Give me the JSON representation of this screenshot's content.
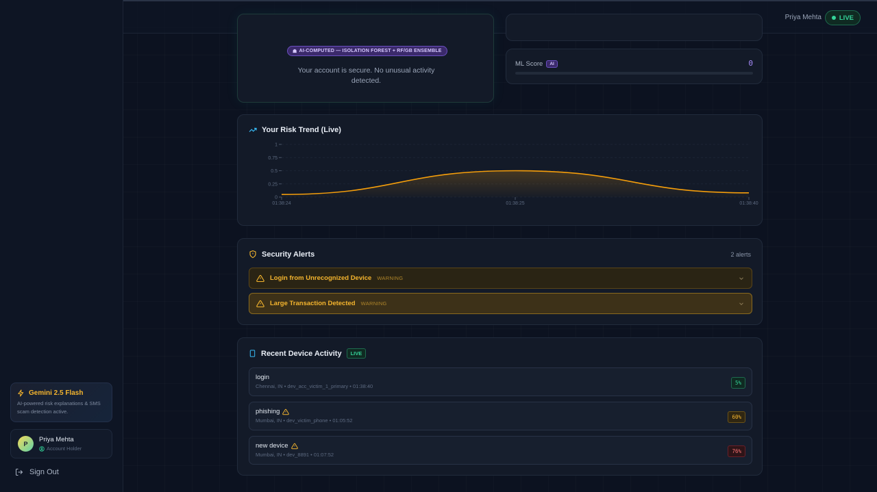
{
  "sidebar": {
    "gemini": {
      "title": "Gemini 2.5 Flash",
      "description": "AI-powered risk explanations & SMS scam detection active."
    },
    "user": {
      "initial": "P",
      "name": "Priya Mehta",
      "role": "Account Holder"
    },
    "signout_label": "Sign Out"
  },
  "topbar": {
    "user_name": "Priya Mehta",
    "live_label": "LIVE"
  },
  "risk": {
    "badge": "AI-COMPUTED — ISOLATION FOREST + RF/GB ENSEMBLE",
    "message": "Your account is secure. No unusual activity detected."
  },
  "ml_score": {
    "label": "ML Score",
    "tag": "AI",
    "value": "0",
    "fraction": 0
  },
  "trend": {
    "title": "Your Risk Trend (Live)",
    "chart_data": {
      "type": "area",
      "x": [
        "01:38:24",
        "01:38:25",
        "01:38:40"
      ],
      "values": [
        0.05,
        0.5,
        0.08
      ],
      "ylim": [
        0,
        1
      ],
      "yticks": [
        "0",
        "0.25",
        "0.5",
        "0.75",
        "1"
      ],
      "color": "#f59e0b"
    }
  },
  "alerts": {
    "title": "Security Alerts",
    "count": "2 alerts",
    "items": [
      {
        "title": "Login from Unrecognized Device",
        "level": "WARNING"
      },
      {
        "title": "Large Transaction Detected",
        "level": "WARNING"
      }
    ]
  },
  "devices": {
    "title": "Recent Device Activity",
    "live_tag": "LIVE",
    "items": [
      {
        "name": "login",
        "meta": "Chennai, IN • dev_acc_victim_1_primary • 01:38:40",
        "score": "5%",
        "level": "low",
        "warn": false
      },
      {
        "name": "phishing",
        "meta": "Mumbai, IN • dev_victim_phone • 01:05:52",
        "score": "60%",
        "level": "med",
        "warn": true
      },
      {
        "name": "new device",
        "meta": "Mumbai, IN • dev_8891 • 01:07:52",
        "score": "76%",
        "level": "high",
        "warn": true
      }
    ]
  }
}
